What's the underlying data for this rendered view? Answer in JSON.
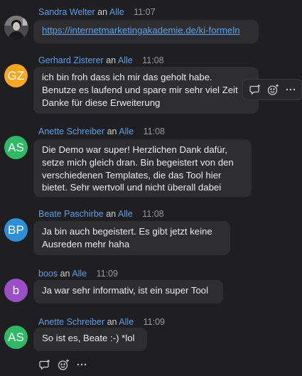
{
  "messages": [
    {
      "sender": "Sandra Welter",
      "to_word": "an",
      "recipient": "Alle",
      "time": "11:07",
      "avatar": {
        "kind": "photo",
        "icon": "user-photo"
      },
      "lines": [
        "https://internetmarketingakademie.de/ki-formeln"
      ],
      "is_link": true
    },
    {
      "sender": "Gerhard Zisterer",
      "to_word": "an",
      "recipient": "Alle",
      "time": "11:08",
      "avatar": {
        "kind": "initials",
        "initials": "GZ",
        "color": "#f5a623"
      },
      "lines": [
        "ich bin froh dass ich mir das geholt habe.",
        "Benutze es laufend und spare mir sehr viel Zeit",
        "Danke für diese Erweiterung"
      ]
    },
    {
      "sender": "Anette Schreiber",
      "to_word": "an",
      "recipient": "Alle",
      "time": "11:08",
      "avatar": {
        "kind": "initials",
        "initials": "AS",
        "color": "#2fb866"
      },
      "lines": [
        "Die Demo war super! Herzlichen Dank dafür,",
        "setze mich gleich dran. Bin begeistert von den",
        "verschiedenen Templates, die das Tool hier",
        "bietet. Sehr wertvoll und nicht überall dabei"
      ]
    },
    {
      "sender": "Beate Paschirbe",
      "to_word": "an",
      "recipient": "Alle",
      "time": "11:08",
      "avatar": {
        "kind": "initials",
        "initials": "BP",
        "color": "#2e8fd6"
      },
      "lines": [
        "Ja bin auch begeistert. Es gibt jetzt keine",
        "Ausreden mehr haha"
      ]
    },
    {
      "sender": "boos",
      "to_word": "an",
      "recipient": "Alle",
      "time": "11:09",
      "avatar": {
        "kind": "initials",
        "initials": "b",
        "color": "#9b4fc4"
      },
      "lines": [
        "Ja war sehr informativ, ist ein super Tool"
      ]
    },
    {
      "sender": "Anette Schreiber",
      "to_word": "an",
      "recipient": "Alle",
      "time": "11:09",
      "avatar": {
        "kind": "initials",
        "initials": "AS",
        "color": "#2fb866"
      },
      "lines": [
        "So ist es, Beate :-) *lol"
      ]
    }
  ],
  "hover_actions": [
    {
      "icon": "reply-in-thread-icon"
    },
    {
      "icon": "add-reaction-icon"
    },
    {
      "icon": "more-options-icon"
    }
  ],
  "bottom_actions": [
    {
      "icon": "reply-in-thread-icon"
    },
    {
      "icon": "add-reaction-icon"
    },
    {
      "icon": "more-options-icon"
    }
  ],
  "colors": {
    "background": "#1f1f21",
    "bubble": "#2e2e31",
    "sender_name": "#5a9de6",
    "link": "#5aa2ee",
    "timestamp": "#9a9a9e"
  }
}
